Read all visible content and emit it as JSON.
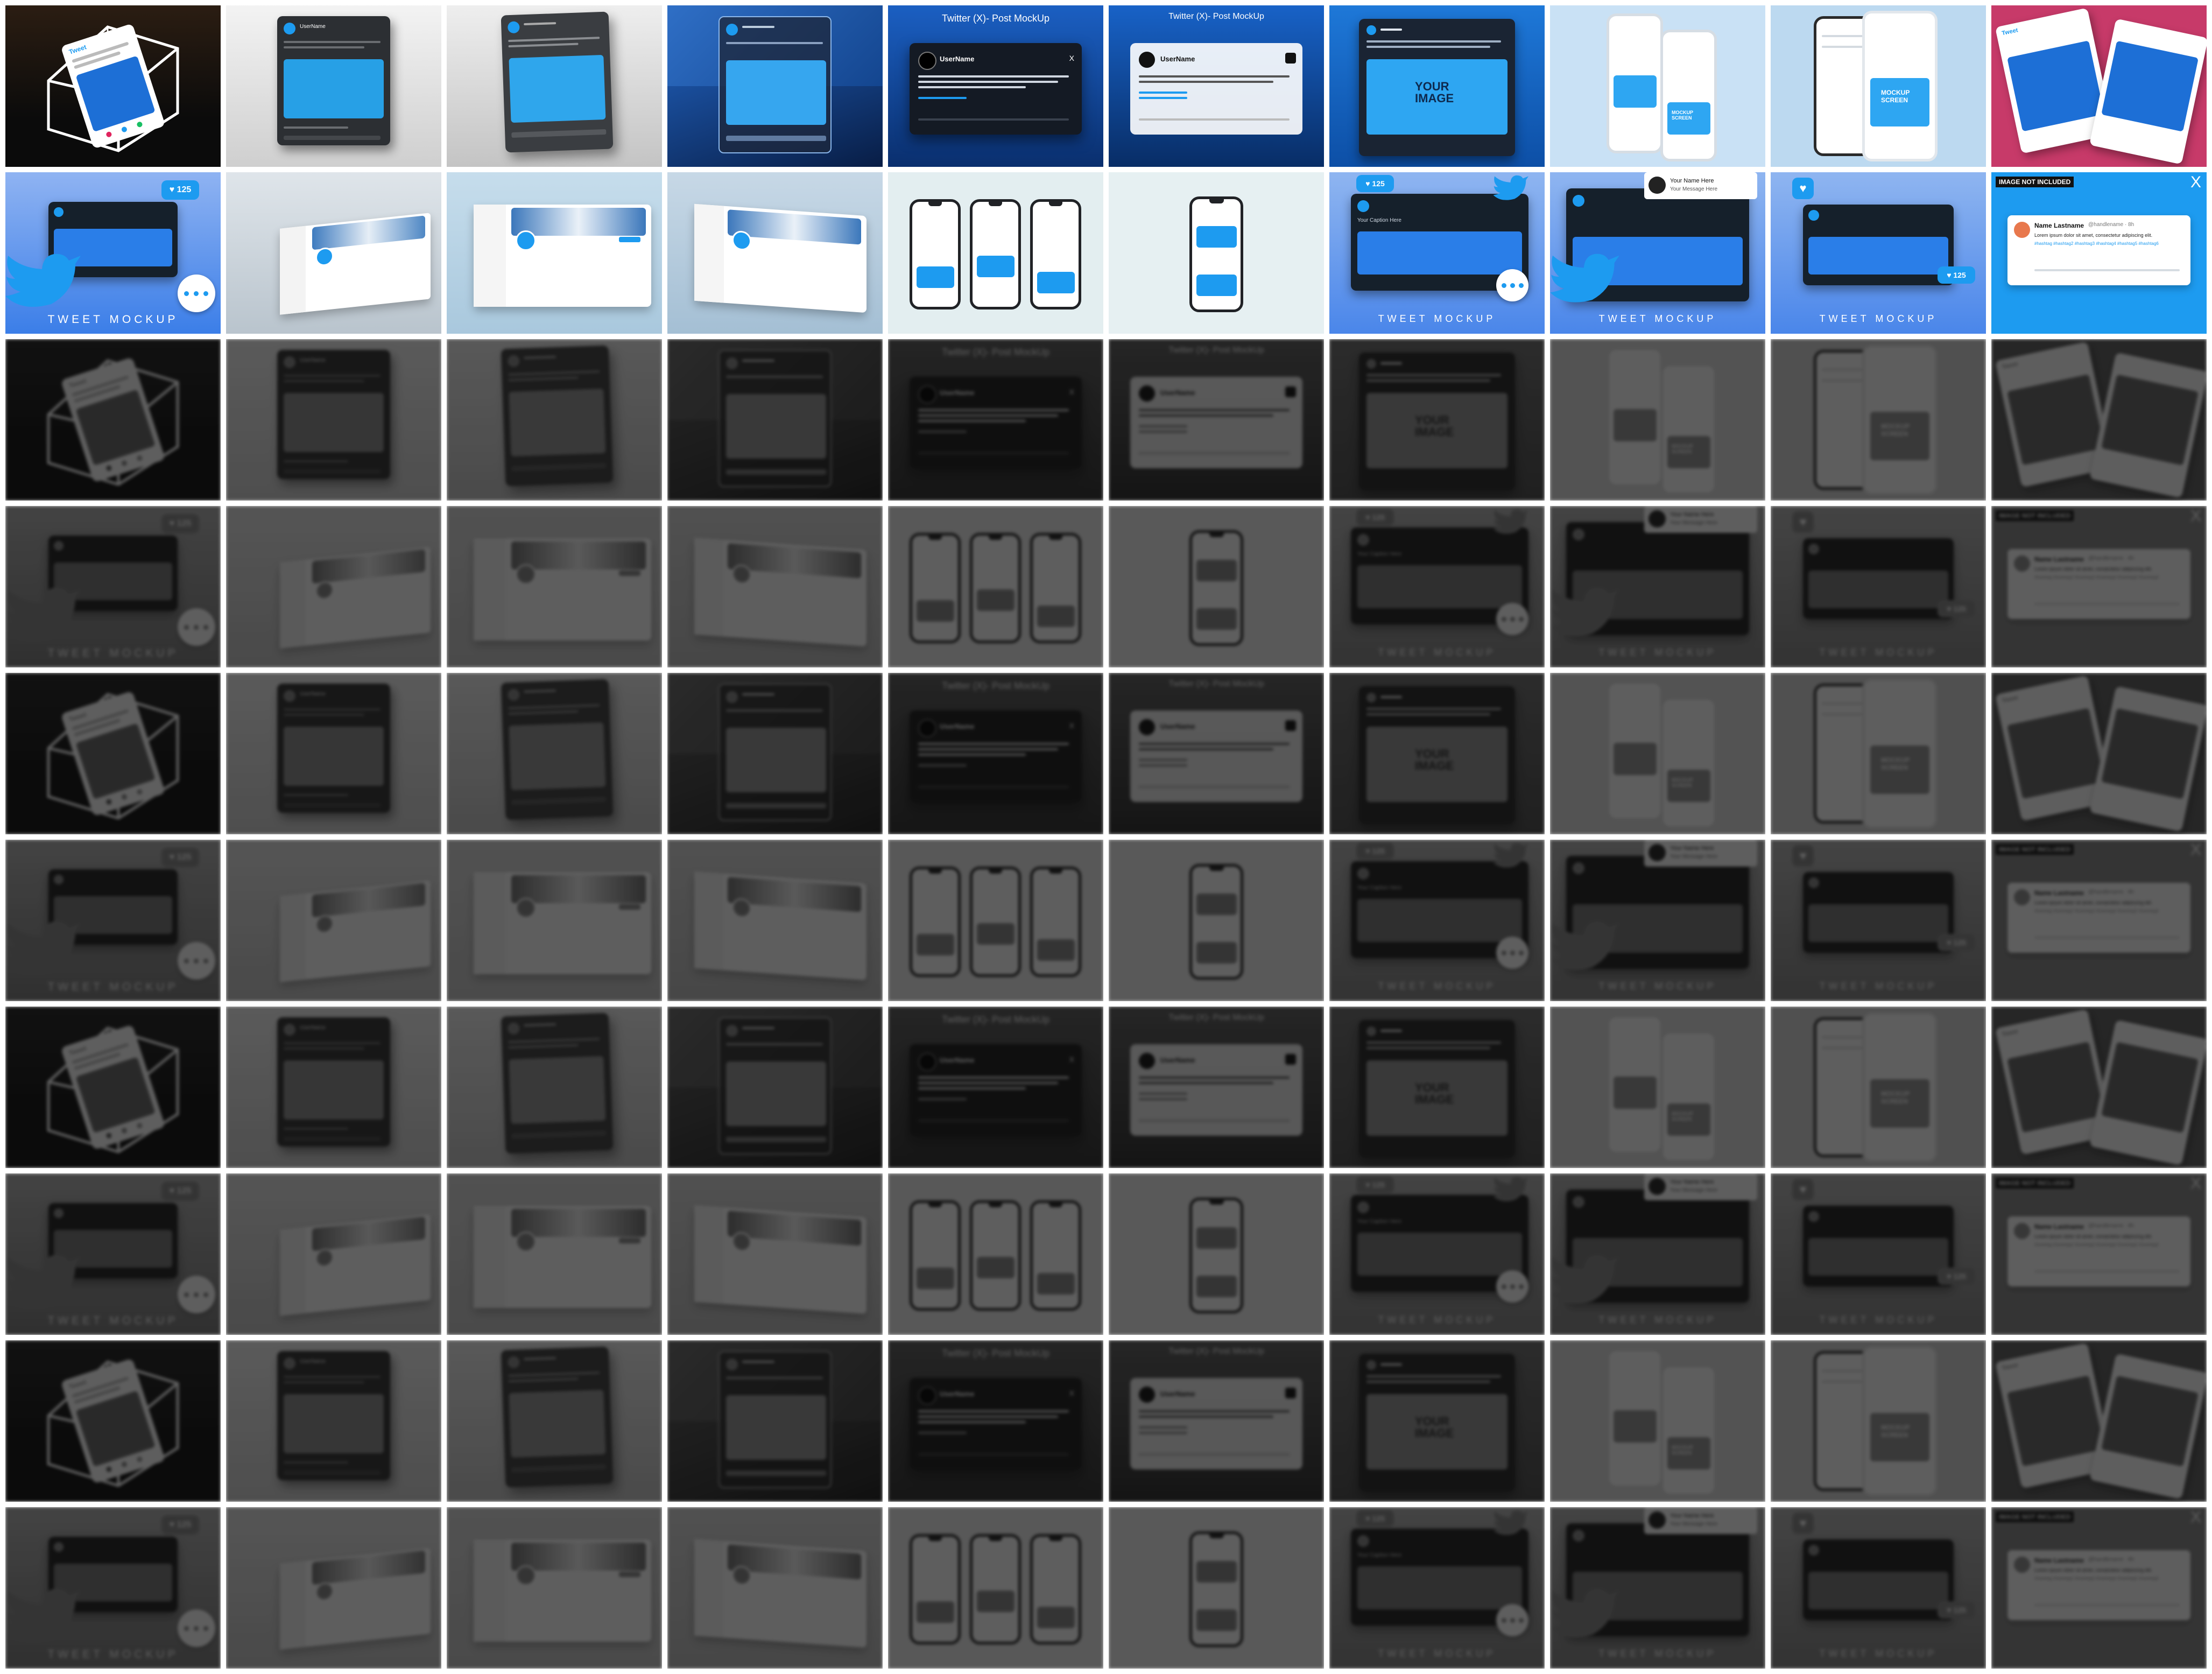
{
  "texts": {
    "tweet": "Tweet",
    "user_name": "UserName",
    "post_mockup": "Twitter (X)- Post MockUp",
    "your_image": "YOUR\nIMAGE",
    "mockup_screen": "MOCKUP\nSCREEN",
    "tweet_mockup": "TWEET MOCKUP",
    "likes": "125",
    "your_caption": "Your Caption Here",
    "your_name": "Your Name Here",
    "your_message": "Your Message Here",
    "image_not_included": "IMAGE NOT INCLUDED",
    "name_lastname": "Name Lastname",
    "handle": "@handlename · 8h",
    "lorem_short": "Lorem ipsum dolor sit amet, consectetur adipiscing elit.",
    "hashtags": "#hashtag #hashtag2 #hashtag3 #hashtag4 #hashtag5 #hashtag6",
    "x_glyph": "X",
    "heart": "♥",
    "camera": "📷"
  },
  "colors": {
    "twitter_blue": "#1d9bf0",
    "dark_card": "#15202b",
    "navy_bg": "#0a3f8f",
    "pink_bg": "#c8386a",
    "light_bg": "#e9ecef"
  },
  "tile_designs": [
    "cube",
    "grey-card",
    "grey-card-2",
    "blue-card",
    "post-mockup-dark",
    "post-mockup-light",
    "your-image",
    "phones-pair",
    "phone-screen",
    "pink-pair",
    "tweet-mockup",
    "profile-tilt",
    "profile-flat",
    "profile-tilt-2",
    "three-phones",
    "single-phone",
    "tweet-mockup-2",
    "tweet-mockup-3",
    "tweet-mockup-4",
    "image-not-included"
  ]
}
